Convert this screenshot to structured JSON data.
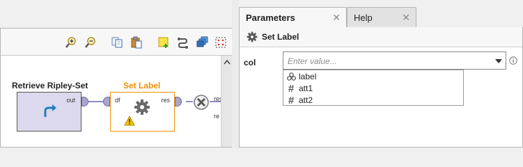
{
  "process": {
    "operators": [
      {
        "title": "Retrieve Ripley-Set",
        "ports_out": [
          "out"
        ],
        "title_color": "#222222"
      },
      {
        "title": "Set Label",
        "ports_in": [
          "df"
        ],
        "ports_out": [
          "res"
        ],
        "title_color": "#f29100",
        "has_warning": true
      }
    ],
    "output_port_labels": [
      "res",
      "re"
    ]
  },
  "tabs": [
    {
      "label": "Parameters",
      "close": "✕",
      "active": true
    },
    {
      "label": "Help",
      "close": "✕",
      "active": false
    }
  ],
  "parameters": {
    "operator_name": "Set Label",
    "param_name": "col",
    "input_placeholder": "Enter value...",
    "options": [
      {
        "label": "label",
        "icon": "role-icon"
      },
      {
        "label": "att1",
        "icon": "hash-icon"
      },
      {
        "label": "att2",
        "icon": "hash-icon"
      }
    ]
  },
  "icons": {
    "hash_glyph": "#"
  },
  "colors": {
    "operator_fill": "#dcd9ee",
    "port_fill": "#a9a5cf",
    "accent_orange": "#f29100",
    "connection": "#8f8bc5"
  }
}
